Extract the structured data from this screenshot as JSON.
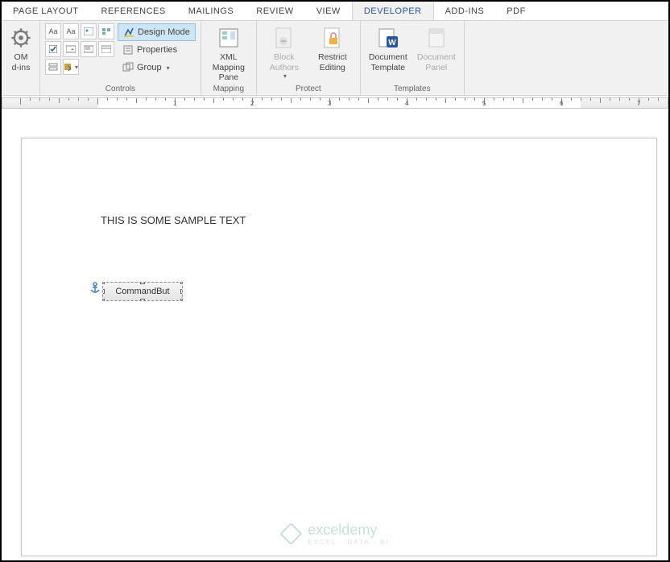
{
  "tabs": {
    "page_layout": "PAGE LAYOUT",
    "references": "REFERENCES",
    "mailings": "MAILINGS",
    "review": "REVIEW",
    "view": "VIEW",
    "developer": "DEVELOPER",
    "addins": "ADD-INS",
    "pdf": "PDF"
  },
  "ribbon": {
    "code": {
      "om": "OM",
      "dins": "d-ins"
    },
    "controls": {
      "label": "Controls",
      "design_mode": "Design Mode",
      "properties": "Properties",
      "group": "Group"
    },
    "mapping": {
      "label": "Mapping",
      "xml": "XML Mapping Pane"
    },
    "protect": {
      "label": "Protect",
      "block": "Block Authors",
      "restrict": "Restrict Editing"
    },
    "templates": {
      "label": "Templates",
      "doc_template": "Document Template",
      "doc_panel": "Document Panel"
    }
  },
  "document": {
    "sample_text": "THIS IS SOME SAMPLE TEXT",
    "command_button": "CommandBut"
  },
  "watermark": {
    "name": "exceldemy",
    "sub": "EXCEL · DATA · BI"
  },
  "ruler_numbers": [
    "1",
    "2",
    "3",
    "4",
    "5",
    "6",
    "7"
  ]
}
